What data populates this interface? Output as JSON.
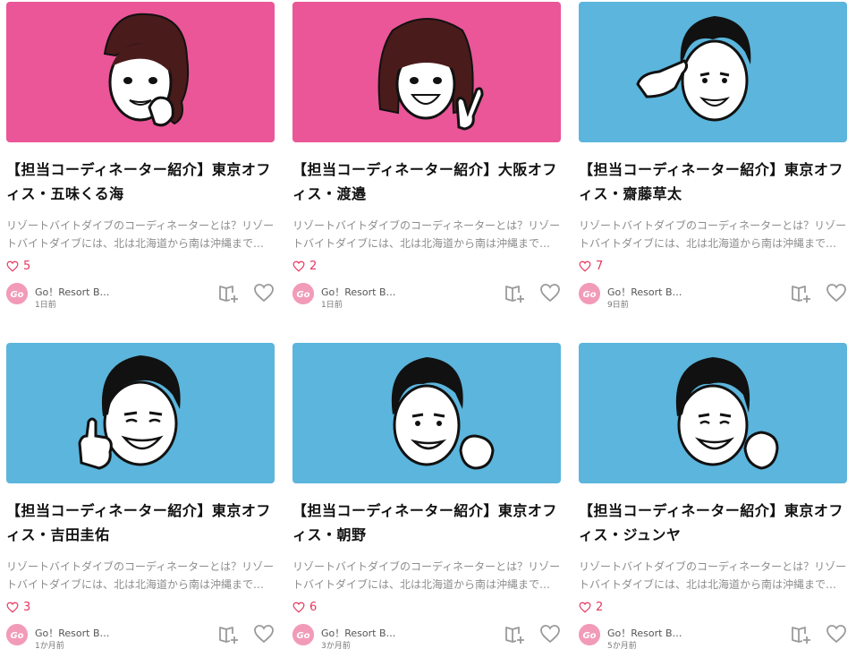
{
  "colors": {
    "pink": "#ea5697",
    "blue": "#5bb5dc",
    "like_red": "#e5365f",
    "muted_text": "#8c8c8c"
  },
  "cards": [
    {
      "title": "【担当コーディネーター紹介】東京オフィス・五味くる海",
      "excerpt": "リゾートバイトダイブのコーディネーターとは？リゾートバイトダイブには、北は北海道から南は沖縄まで全国各地",
      "likes": "5",
      "author": "Go！Resort B…",
      "time": "1日前",
      "bg": "pink",
      "illustration": "coordinator-portrait-woman-wavy-hair"
    },
    {
      "title": "【担当コーディネーター紹介】大阪オフィス・渡邉",
      "excerpt": "リゾートバイトダイブのコーディネーターとは？リゾートバイトダイブには、北は北海道から南は沖縄まで全国各地",
      "likes": "2",
      "author": "Go！Resort B…",
      "time": "1日前",
      "bg": "pink",
      "illustration": "coordinator-portrait-woman-peace-sign"
    },
    {
      "title": "【担当コーディネーター紹介】東京オフィス・齋藤草太",
      "excerpt": "リゾートバイトダイブのコーディネーターとは？リゾートバイトダイブには、北は北海道から南は沖縄まで全国各地",
      "likes": "7",
      "author": "Go！Resort B…",
      "time": "9日前",
      "bg": "blue",
      "illustration": "coordinator-portrait-man-salute"
    },
    {
      "title": "【担当コーディネーター紹介】東京オフィス・吉田圭佑",
      "excerpt": "リゾートバイトダイブのコーディネーターとは？リゾートバイトダイブには、北は北海道から南は沖縄まで全国各地",
      "likes": "3",
      "author": "Go！Resort B…",
      "time": "1か月前",
      "bg": "blue",
      "illustration": "coordinator-portrait-man-thumbs-up"
    },
    {
      "title": "【担当コーディネーター紹介】東京オフィス・朝野",
      "excerpt": "リゾートバイトダイブのコーディネーターとは？リゾートバイトダイブには、北は北海道から南は沖縄まで全国各地",
      "likes": "6",
      "author": "Go！Resort B…",
      "time": "3か月前",
      "bg": "blue",
      "illustration": "coordinator-portrait-man-fist"
    },
    {
      "title": "【担当コーディネーター紹介】東京オフィス・ジュンヤ",
      "excerpt": "リゾートバイトダイブのコーディネーターとは？リゾートバイトダイブには、北は北海道から南は沖縄まで全国各地",
      "likes": "2",
      "author": "Go！Resort B…",
      "time": "5か月前",
      "bg": "blue",
      "illustration": "coordinator-portrait-man-fist-smile"
    }
  ]
}
